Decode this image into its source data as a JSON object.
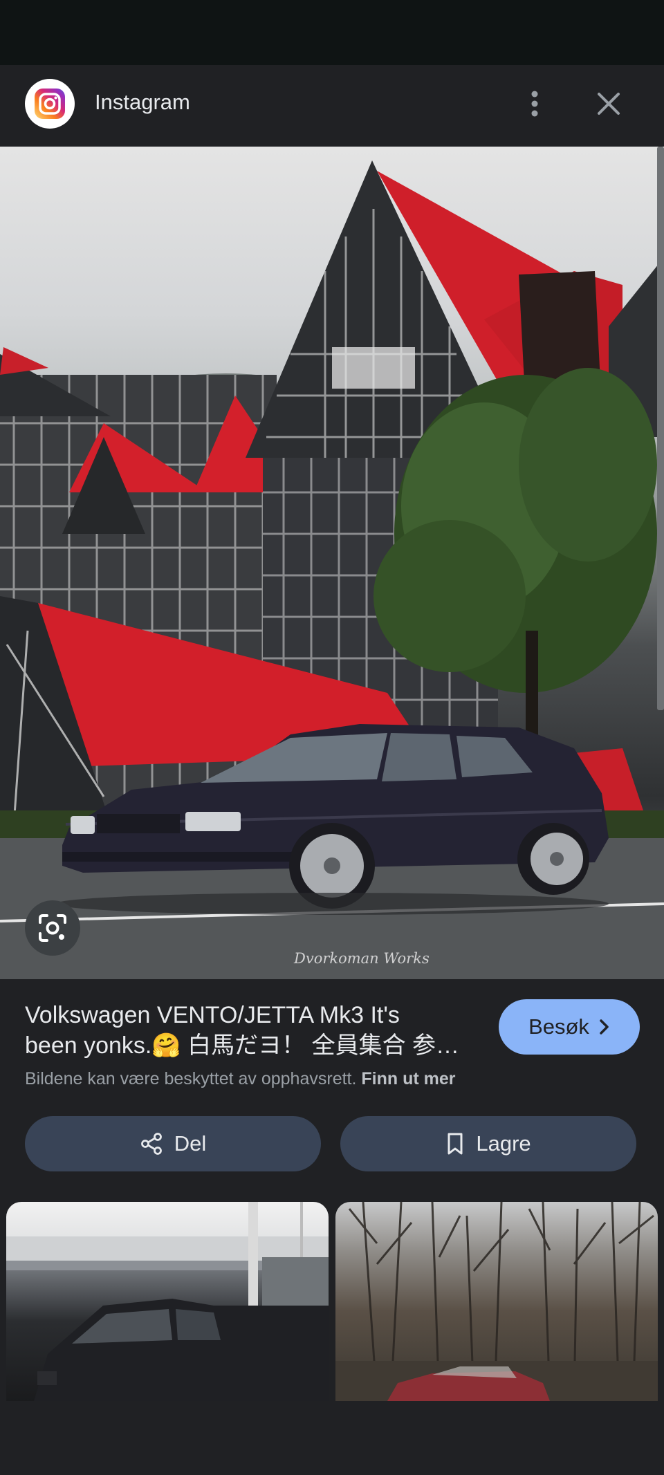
{
  "header": {
    "app_name": "Instagram"
  },
  "image": {
    "watermark": "Dvorkoman Works"
  },
  "result": {
    "title_line1": "Volkswagen VENTO/JETTA Mk3 It's",
    "title_line2": "been yonks.🤗 白馬だヨ！ 全員集合 参…",
    "visit_label": "Besøk",
    "copyright_text": "Bildene kan være beskyttet av opphavsrett.",
    "learn_more": "Finn ut mer"
  },
  "actions": {
    "share_label": "Del",
    "save_label": "Lagre"
  },
  "colors": {
    "background": "#202124",
    "accent": "#8ab4f8",
    "pill": "#394457",
    "roof_red": "#d3202b"
  }
}
